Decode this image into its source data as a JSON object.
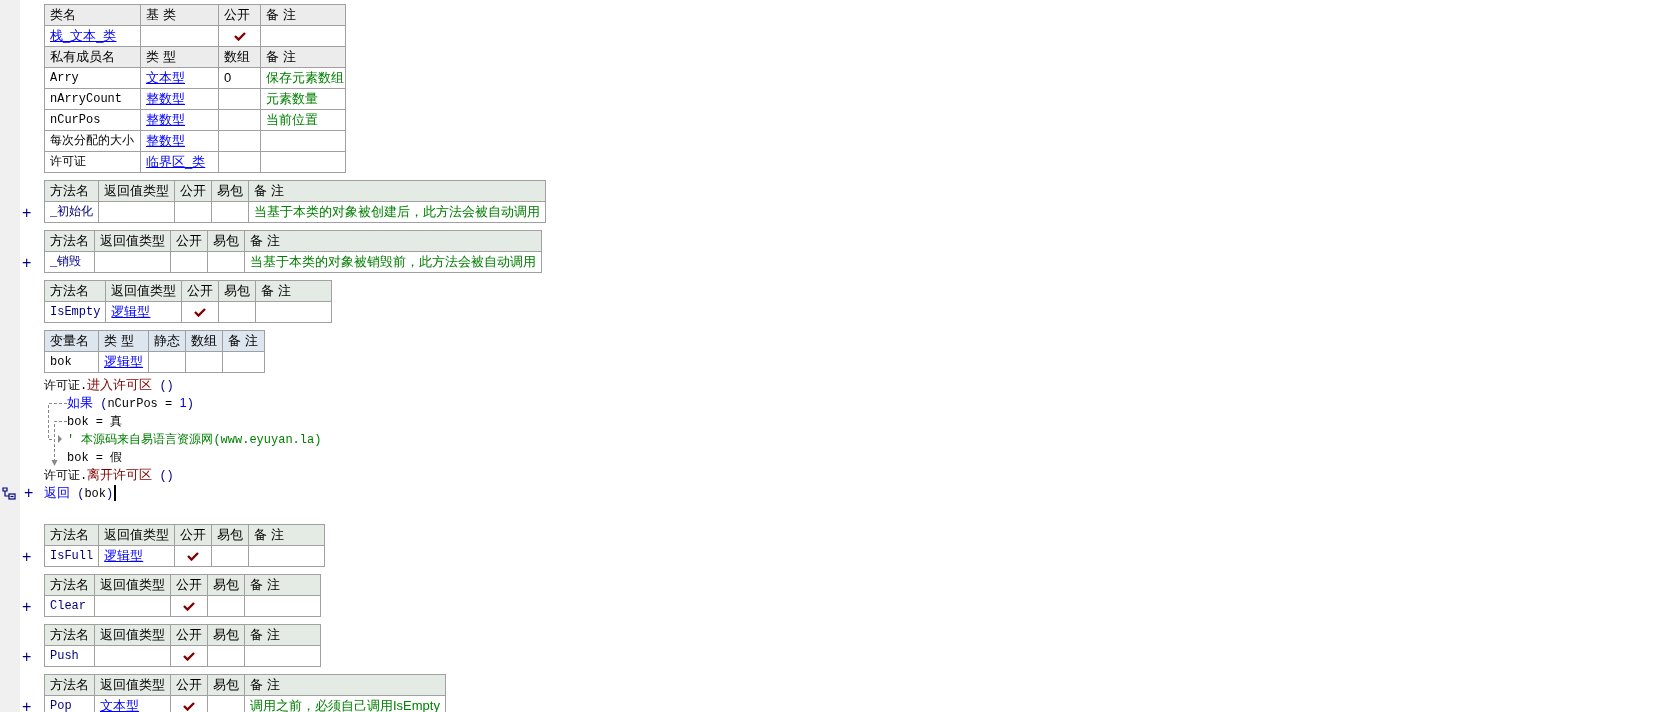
{
  "class_table": {
    "headers": [
      "类名",
      "基 类",
      "公开",
      "备 注"
    ],
    "row": {
      "name": "栈_文本_类",
      "public": true
    },
    "member_headers": [
      "私有成员名",
      "类 型",
      "数组",
      "备 注"
    ],
    "members": [
      {
        "name": "Arry",
        "type": "文本型",
        "array": "0",
        "note": "保存元素数组"
      },
      {
        "name": "nArryCount",
        "type": "整数型",
        "note": "元素数量"
      },
      {
        "name": "nCurPos",
        "type": "整数型",
        "note": "当前位置"
      },
      {
        "name": "每次分配的大小",
        "type": "整数型"
      },
      {
        "name": "许可证",
        "type": "临界区_类"
      }
    ]
  },
  "methods": [
    {
      "headers": [
        "方法名",
        "返回值类型",
        "公开",
        "易包",
        "备 注"
      ],
      "expander": "+",
      "name": "_初始化",
      "public": false,
      "note": "当基于本类的对象被创建后，此方法会被自动调用"
    },
    {
      "headers": [
        "方法名",
        "返回值类型",
        "公开",
        "易包",
        "备 注"
      ],
      "expander": "+",
      "name": "_销毁",
      "public": false,
      "note": "当基于本类的对象被销毁前，此方法会被自动调用"
    },
    {
      "headers": [
        "方法名",
        "返回值类型",
        "公开",
        "易包",
        "备 注"
      ],
      "name": "IsEmpty",
      "return_type": "逻辑型",
      "public": true,
      "local_headers": [
        "变量名",
        "类 型",
        "静态",
        "数组",
        "备 注"
      ],
      "locals": [
        {
          "name": "bok",
          "type": "逻辑型"
        }
      ],
      "code": [
        {
          "kind": "stmt",
          "segments": [
            {
              "kind": "plain",
              "text": "许可证."
            },
            {
              "kind": "command",
              "text": "进入许可区"
            },
            {
              "kind": "paren",
              "text": " ()"
            }
          ]
        },
        {
          "kind": "if",
          "segments": [
            {
              "kind": "keyword",
              "text": "如果"
            },
            {
              "kind": "paren",
              "text": " ("
            },
            {
              "kind": "plain",
              "text": "nCurPos = "
            },
            {
              "kind": "keyword",
              "text": "1"
            },
            {
              "kind": "paren",
              "text": ")"
            }
          ],
          "children": [
            {
              "kind": "stmt",
              "segments": [
                {
                  "kind": "plain",
                  "text": "bok = 真"
                }
              ]
            },
            {
              "kind": "comment",
              "segments": [
                {
                  "kind": "comment",
                  "text": "' 本源码来自易语言资源网(www.eyuyan.la)"
                }
              ]
            },
            {
              "kind": "stmt",
              "segments": [
                {
                  "kind": "plain",
                  "text": "bok = 假"
                }
              ]
            }
          ]
        },
        {
          "kind": "stmt",
          "segments": [
            {
              "kind": "plain",
              "text": "许可证."
            },
            {
              "kind": "command",
              "text": "离开许可区"
            },
            {
              "kind": "paren",
              "text": " ()"
            }
          ]
        },
        {
          "kind": "stmt",
          "marker": "+",
          "flagged": true,
          "cursor": true,
          "segments": [
            {
              "kind": "keyword",
              "text": "返回"
            },
            {
              "kind": "paren",
              "text": " ("
            },
            {
              "kind": "plain",
              "text": "bok"
            },
            {
              "kind": "paren",
              "text": ")"
            }
          ]
        }
      ]
    },
    {
      "headers": [
        "方法名",
        "返回值类型",
        "公开",
        "易包",
        "备 注"
      ],
      "expander": "+",
      "name": "IsFull",
      "return_type": "逻辑型",
      "public": true
    },
    {
      "headers": [
        "方法名",
        "返回值类型",
        "公开",
        "易包",
        "备 注"
      ],
      "expander": "+",
      "name": "Clear",
      "public": true
    },
    {
      "headers": [
        "方法名",
        "返回值类型",
        "公开",
        "易包",
        "备 注"
      ],
      "expander": "+",
      "name": "Push",
      "public": true
    },
    {
      "headers": [
        "方法名",
        "返回值类型",
        "公开",
        "易包",
        "备 注"
      ],
      "expander": "+",
      "name": "Pop",
      "return_type": "文本型",
      "public": true,
      "note": "调用之前，必须自己调用IsEmpty"
    }
  ]
}
